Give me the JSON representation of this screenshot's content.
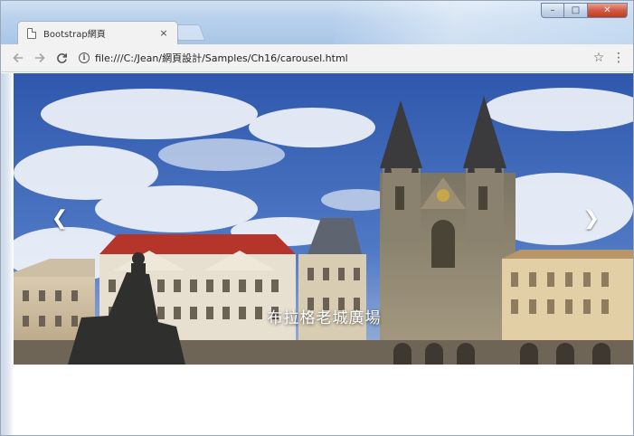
{
  "browser": {
    "tab_title": "Bootstrap網頁",
    "tab_close": "×",
    "url": "file:///C:/Jean/網頁設計/Samples/Ch16/carousel.html",
    "back_icon": "arrow-left-icon",
    "forward_icon": "arrow-right-icon",
    "reload_icon": "reload-icon",
    "star_icon": "star-icon",
    "menu_icon": "kebab-menu-icon",
    "window_controls": {
      "minimize": "–",
      "maximize": "□",
      "close": "✕"
    }
  },
  "carousel": {
    "caption": "布拉格老城廣場",
    "prev_icon": "chevron-left-icon",
    "next_icon": "chevron-right-icon",
    "prev_glyph": "❮",
    "next_glyph": "❯"
  },
  "colors": {
    "sky": "#3a63b5",
    "roof_red": "#b5352a",
    "stone": "#cdbb9a",
    "window_close": "#c13b24"
  }
}
